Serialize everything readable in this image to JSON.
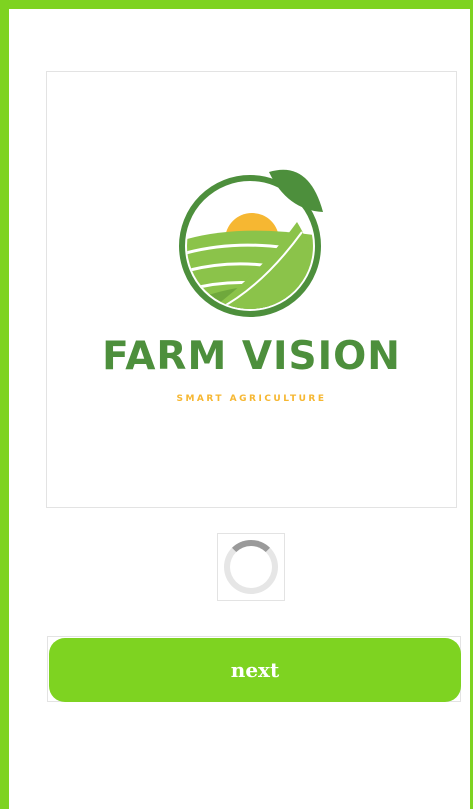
{
  "app": {
    "brand_title": "FARM VISION",
    "brand_tagline": "SMART AGRICULTURE"
  },
  "loading": {
    "spinner_icon": "loading-spinner"
  },
  "actions": {
    "next_label": "next"
  },
  "colors": {
    "accent": "#7ed321",
    "brand_green": "#4d8f3c",
    "leaf_light": "#8bc34a",
    "sun": "#f6b732"
  }
}
